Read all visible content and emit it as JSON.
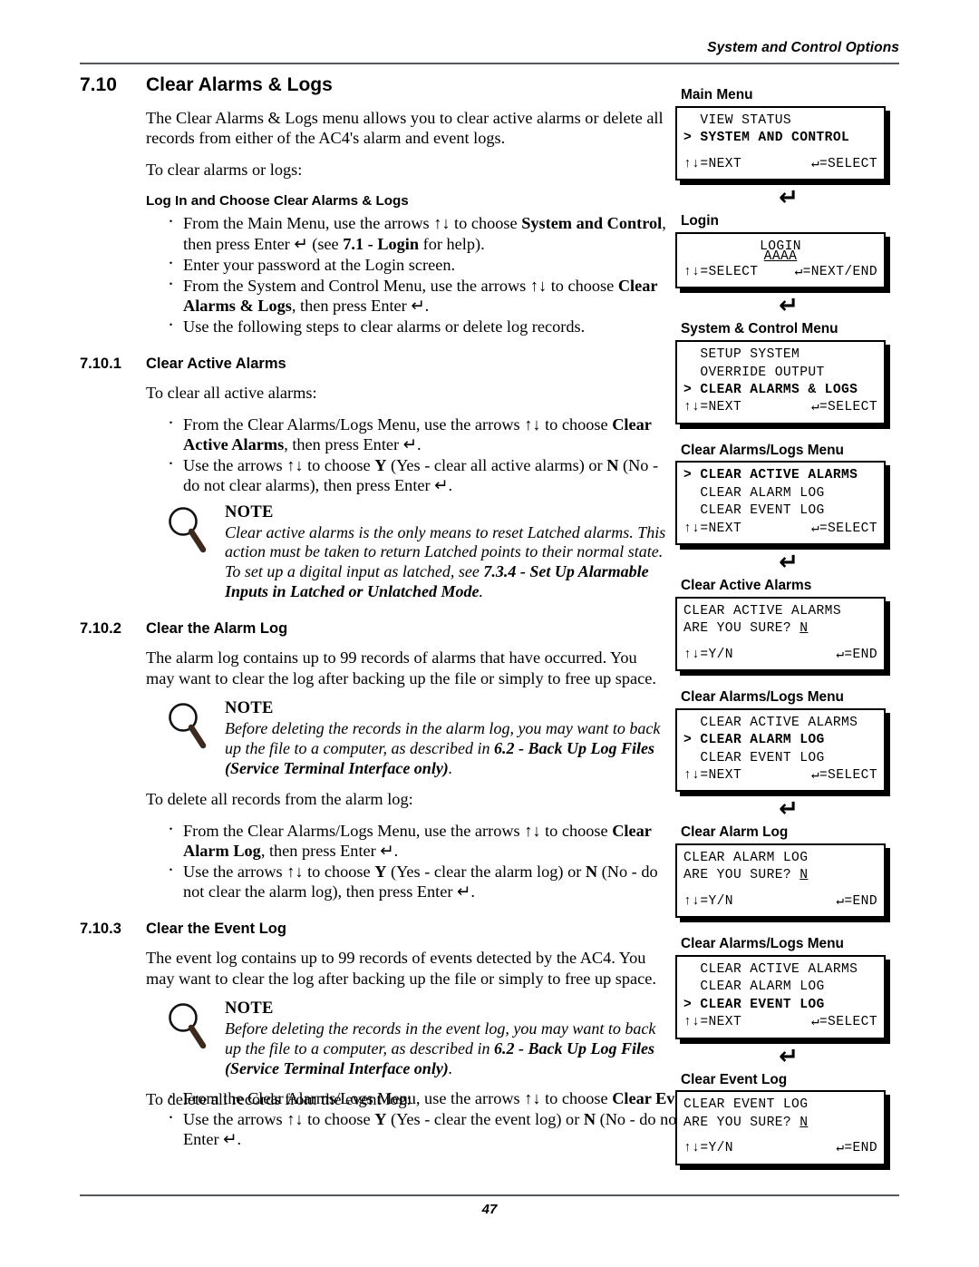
{
  "header": {
    "running_title": "System and Control Options"
  },
  "footer": {
    "page_number": "47"
  },
  "section": {
    "number": "7.10",
    "title": "Clear Alarms & Logs",
    "intro": "The Clear Alarms & Logs menu allows you to clear active alarms or delete all records from either of the AC4's alarm and event logs.",
    "lead_in": "To clear alarms or logs:",
    "login_heading": "Log In and Choose Clear Alarms & Logs",
    "login_bullets": [
      "From the Main Menu, use the arrows ↑↓ to choose System and Control, then press Enter ↵ (see 7.1 - Login for help).",
      "Enter your password at the Login screen.",
      "From the System and Control Menu, use the arrows ↑↓ to choose Clear Alarms & Logs, then press Enter ↵.",
      "Use the following steps to clear alarms or delete log records."
    ]
  },
  "sub1": {
    "number": "7.10.1",
    "title": "Clear Active Alarms",
    "lead_in": "To clear all active alarms:",
    "bullets": [
      "From the Clear Alarms/Logs Menu, use the arrows ↑↓ to choose Clear Active Alarms, then press Enter ↵.",
      "Use the arrows ↑↓ to choose Y (Yes - clear all active alarms) or N (No - do not clear alarms), then press Enter ↵."
    ],
    "note": {
      "title": "NOTE",
      "text": "Clear active alarms is the only means to reset Latched alarms. This action must be taken to return Latched points to their normal state. To set up a digital input as latched, see 7.3.4 - Set Up Alarmable Inputs in Latched or Unlatched Mode."
    }
  },
  "sub2": {
    "number": "7.10.2",
    "title": "Clear the Alarm Log",
    "intro": "The alarm log contains up to 99 records of alarms that have occurred. You may want to clear the log after backing up the file or simply to free up space.",
    "note": {
      "title": "NOTE",
      "text": "Before deleting the records in the alarm log, you may want to back up the file to a computer, as described in 6.2 - Back Up Log Files (Service Terminal Interface only)."
    },
    "lead_in": "To delete all records from the alarm log:",
    "bullets": [
      "From the Clear Alarms/Logs Menu, use the arrows ↑↓ to choose Clear Alarm Log, then press Enter ↵.",
      "Use the arrows ↑↓ to choose Y (Yes - clear the alarm log) or N (No - do not clear the alarm log), then press Enter ↵."
    ]
  },
  "sub3": {
    "number": "7.10.3",
    "title": "Clear the Event Log",
    "intro": "The event log contains up to 99 records of events detected by the AC4. You may want to clear the log after backing up the file or simply to free up space.",
    "note": {
      "title": "NOTE",
      "text": "Before deleting the records in the event log, you may want to back up the file to a computer, as described in 6.2 - Back Up Log Files (Service Terminal Interface only)."
    },
    "lead_in": "To delete all records from the event log:",
    "bullets": [
      "From the Clear Alarms/Logs Menu, use the arrows ↑↓ to choose Clear Event Log, then press Enter ↵.",
      "Use the arrows ↑↓ to choose Y (Yes - clear the event log) or N (No - do not clear the event log), then press Enter ↵."
    ]
  },
  "panels": {
    "main_menu": {
      "label": "Main Menu",
      "rows": [
        "  VIEW STATUS",
        "> SYSTEM AND CONTROL"
      ],
      "foot_left": "↑↓=NEXT",
      "foot_right": "↵=SELECT"
    },
    "login": {
      "label": "Login",
      "title_row": "LOGIN",
      "value": "AAAA",
      "foot_left": "↑↓=SELECT",
      "foot_right": "↵=NEXT/END"
    },
    "system_control": {
      "label": "System & Control Menu",
      "rows": [
        "  SETUP SYSTEM",
        "  OVERRIDE OUTPUT",
        "> CLEAR ALARMS & LOGS"
      ],
      "foot_left": "↑↓=NEXT",
      "foot_right": "↵=SELECT"
    },
    "clear_menu_1": {
      "label": "Clear Alarms/Logs Menu",
      "rows": [
        "> CLEAR ACTIVE ALARMS",
        "  CLEAR ALARM LOG",
        "  CLEAR EVENT LOG"
      ],
      "foot_left": "↑↓=NEXT",
      "foot_right": "↵=SELECT"
    },
    "confirm_active": {
      "label": "Clear Active Alarms",
      "row1": "CLEAR ACTIVE ALARMS",
      "row2_prompt": "ARE YOU SURE? ",
      "row2_value": "N",
      "foot_left": "↑↓=Y/N",
      "foot_right": "↵=END"
    },
    "clear_menu_2": {
      "label": "Clear Alarms/Logs Menu",
      "rows": [
        "  CLEAR ACTIVE ALARMS",
        "> CLEAR ALARM LOG",
        "  CLEAR EVENT LOG"
      ],
      "foot_left": "↑↓=NEXT",
      "foot_right": "↵=SELECT"
    },
    "confirm_alarm_log": {
      "label": "Clear Alarm Log",
      "row1": "CLEAR ALARM LOG",
      "row2_prompt": "ARE YOU SURE? ",
      "row2_value": "N",
      "foot_left": "↑↓=Y/N",
      "foot_right": "↵=END"
    },
    "clear_menu_3": {
      "label": "Clear Alarms/Logs Menu",
      "rows": [
        "  CLEAR ACTIVE ALARMS",
        "  CLEAR ALARM LOG",
        "> CLEAR EVENT LOG"
      ],
      "foot_left": "↑↓=NEXT",
      "foot_right": "↵=SELECT"
    },
    "confirm_event_log": {
      "label": "Clear Event Log",
      "row1": "CLEAR EVENT LOG",
      "row2_prompt": "ARE YOU SURE? ",
      "row2_value": "N",
      "foot_left": "↑↓=Y/N",
      "foot_right": "↵=END"
    },
    "connector": "↵"
  }
}
